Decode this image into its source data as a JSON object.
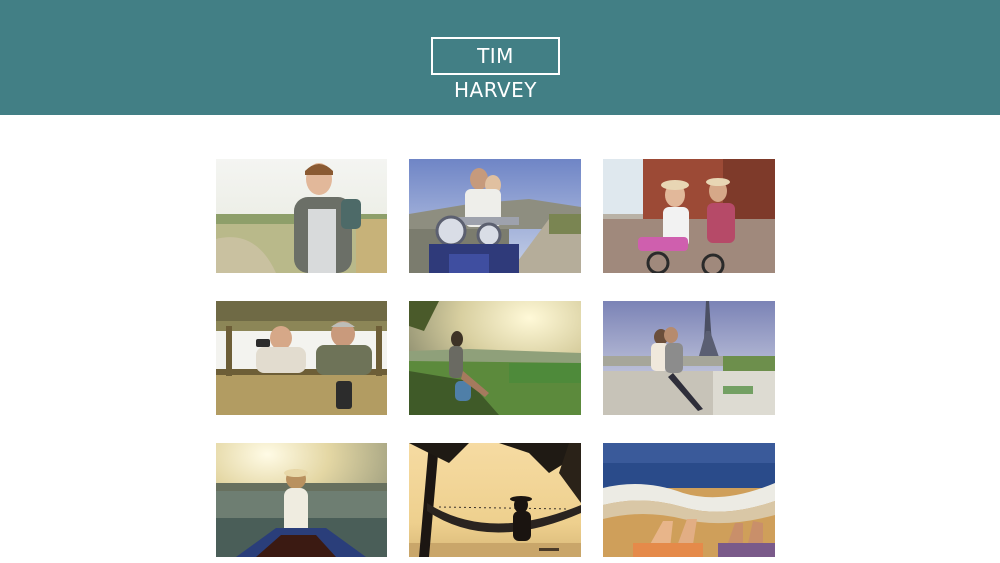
{
  "site": {
    "title": "TIM HARVEY"
  },
  "colors": {
    "header": "#427f85",
    "background": "#ffffff"
  },
  "gallery": [
    {
      "name": "photo-hiker-young-man"
    },
    {
      "name": "photo-motorcycle-couple"
    },
    {
      "name": "photo-bicycle-couple"
    },
    {
      "name": "photo-safari-binoculars"
    },
    {
      "name": "photo-woman-hilltop-view"
    },
    {
      "name": "photo-paris-eiffel-couple"
    },
    {
      "name": "photo-boat-sunset"
    },
    {
      "name": "photo-hammock-sunset"
    },
    {
      "name": "photo-beach-feet-waves"
    }
  ]
}
